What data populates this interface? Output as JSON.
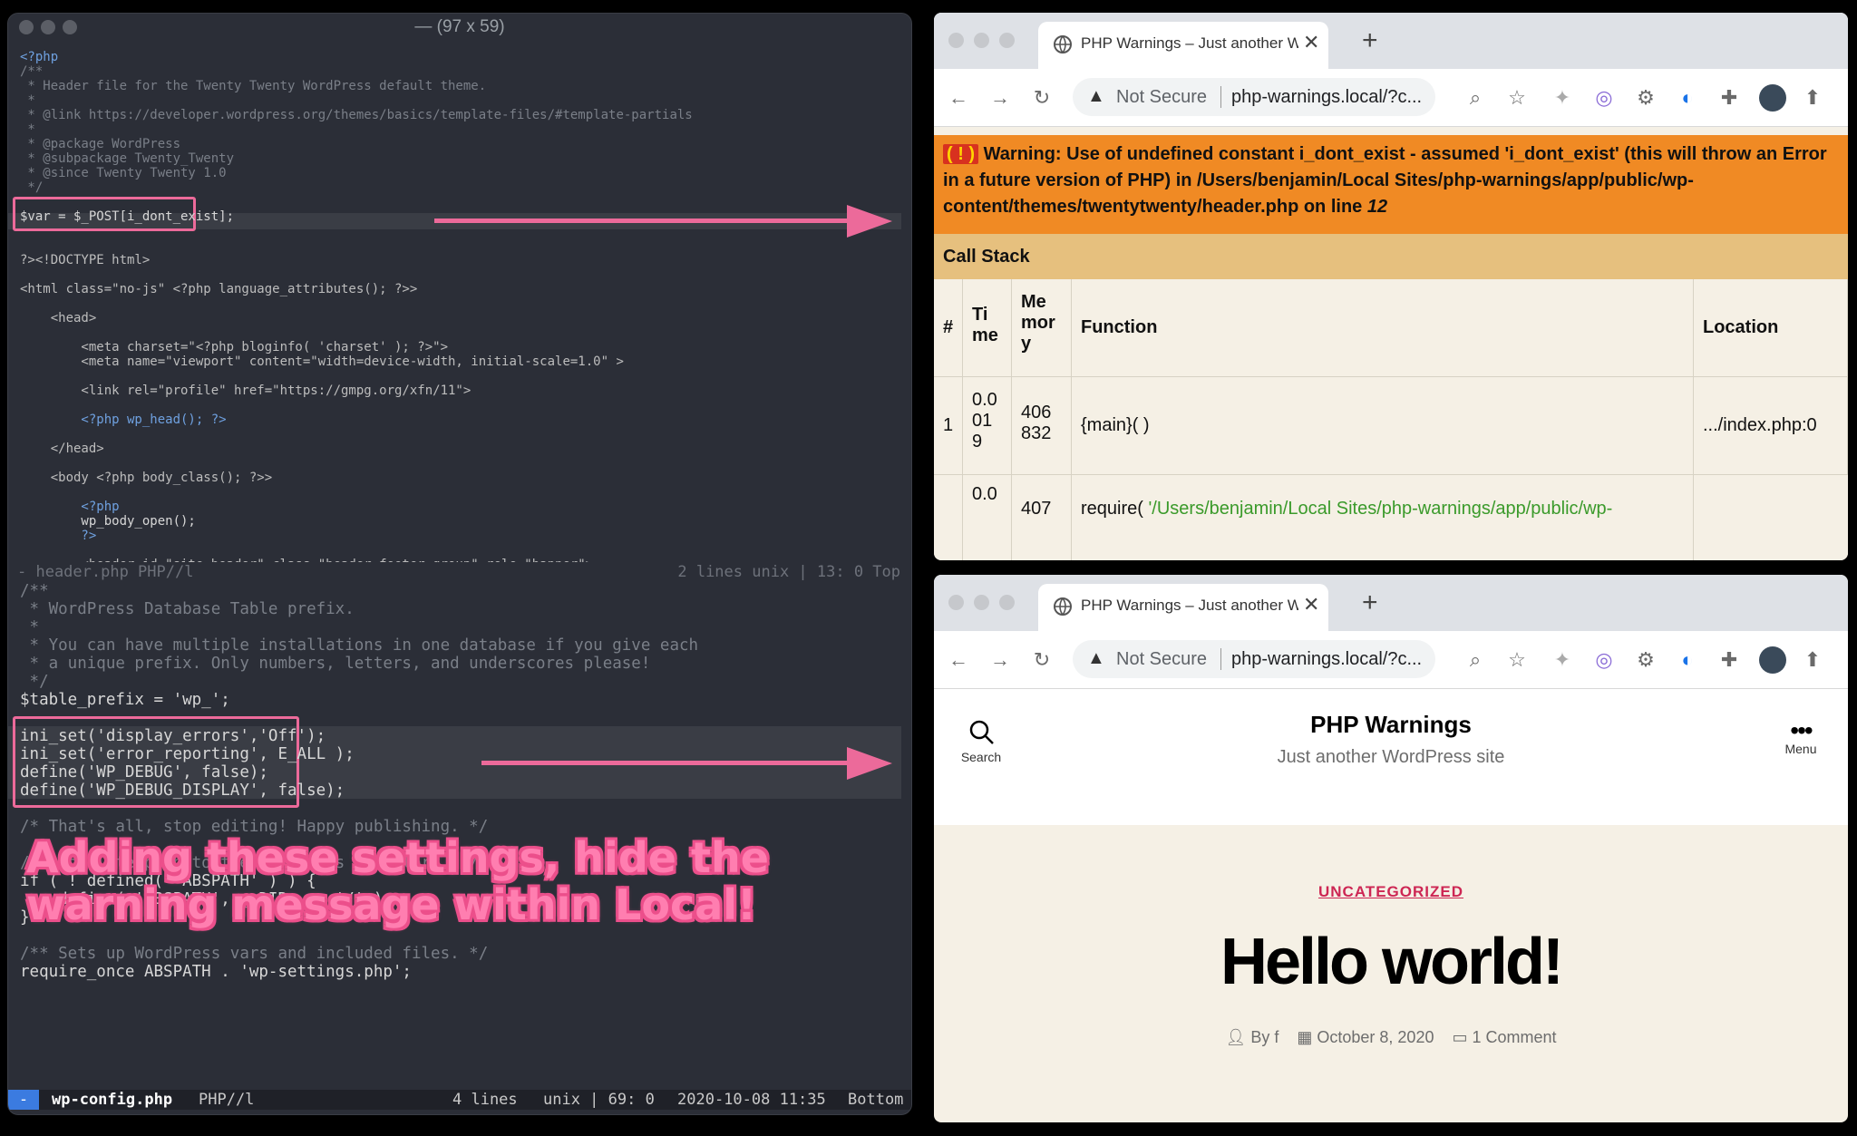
{
  "terminal": {
    "title": "— (97 x 59)",
    "top_file": {
      "lines": [
        {
          "t": "<?php",
          "c": "kw"
        },
        {
          "t": "/**",
          "c": "cm"
        },
        {
          "t": " * Header file for the Twenty Twenty WordPress default theme.",
          "c": "cm"
        },
        {
          "t": " *",
          "c": "cm"
        },
        {
          "t": " * @link https://developer.wordpress.org/themes/basics/template-files/#template-partials",
          "c": "cm"
        },
        {
          "t": " *",
          "c": "cm"
        },
        {
          "t": " * @package WordPress",
          "c": "cm"
        },
        {
          "t": " * @subpackage Twenty_Twenty",
          "c": "cm"
        },
        {
          "t": " * @since Twenty Twenty 1.0",
          "c": "cm"
        },
        {
          "t": " */",
          "c": "cm"
        },
        {
          "t": "",
          "c": "var"
        },
        {
          "t": "$var = $_POST[i_dont_exist];",
          "c": "var"
        },
        {
          "t": "",
          "c": "var"
        },
        {
          "t": "",
          "c": "var"
        },
        {
          "t": "?><!DOCTYPE html>",
          "c": "tag"
        },
        {
          "t": "",
          "c": "var"
        },
        {
          "t": "<html class=\"no-js\" <?php language_attributes(); ?>>",
          "c": "tag"
        },
        {
          "t": "",
          "c": "var"
        },
        {
          "t": "    <head>",
          "c": "tag"
        },
        {
          "t": "",
          "c": "var"
        },
        {
          "t": "        <meta charset=\"<?php bloginfo( 'charset' ); ?>\">",
          "c": "tag"
        },
        {
          "t": "        <meta name=\"viewport\" content=\"width=device-width, initial-scale=1.0\" >",
          "c": "tag"
        },
        {
          "t": "",
          "c": "var"
        },
        {
          "t": "        <link rel=\"profile\" href=\"https://gmpg.org/xfn/11\">",
          "c": "tag"
        },
        {
          "t": "",
          "c": "var"
        },
        {
          "t": "        <?php wp_head(); ?>",
          "c": "kw"
        },
        {
          "t": "",
          "c": "var"
        },
        {
          "t": "    </head>",
          "c": "tag"
        },
        {
          "t": "",
          "c": "var"
        },
        {
          "t": "    <body <?php body_class(); ?>>",
          "c": "tag"
        },
        {
          "t": "",
          "c": "var"
        },
        {
          "t": "        <?php",
          "c": "kw"
        },
        {
          "t": "        wp_body_open();",
          "c": "var"
        },
        {
          "t": "        ?>",
          "c": "kw"
        },
        {
          "t": "",
          "c": "var"
        },
        {
          "t": "        <header id=\"site-header\" class=\"header-footer-group\" role=\"banner\">",
          "c": "tag"
        }
      ],
      "status": {
        "left": "-  header.php   PHP//l",
        "right": "2 lines   unix | 13: 0   Top"
      }
    },
    "bottom_file": {
      "lines": [
        {
          "t": "/**",
          "c": "cm"
        },
        {
          "t": " * WordPress Database Table prefix.",
          "c": "cm"
        },
        {
          "t": " *",
          "c": "cm"
        },
        {
          "t": " * You can have multiple installations in one database if you give each",
          "c": "cm"
        },
        {
          "t": " * a unique prefix. Only numbers, letters, and underscores please!",
          "c": "cm"
        },
        {
          "t": " */",
          "c": "cm"
        },
        {
          "t": "$table_prefix = 'wp_';",
          "c": "var"
        },
        {
          "t": "",
          "c": "var"
        },
        {
          "t": "ini_set('display_errors','Off');",
          "c": "var"
        },
        {
          "t": "ini_set('error_reporting', E_ALL );",
          "c": "var"
        },
        {
          "t": "define('WP_DEBUG', false);",
          "c": "var"
        },
        {
          "t": "define('WP_DEBUG_DISPLAY', false);",
          "c": "var"
        },
        {
          "t": "",
          "c": "var"
        },
        {
          "t": "/* That's all, stop editing! Happy publishing. */",
          "c": "cm"
        },
        {
          "t": "",
          "c": "var"
        },
        {
          "t": "/** Absolute path to the WordPress directory. */",
          "c": "cm"
        },
        {
          "t": "if ( ! defined( 'ABSPATH' ) ) {",
          "c": "var"
        },
        {
          "t": "    define( 'ABSPATH', __DIR__ . '/' );",
          "c": "var"
        },
        {
          "t": "}",
          "c": "var"
        },
        {
          "t": "",
          "c": "var"
        },
        {
          "t": "/** Sets up WordPress vars and included files. */",
          "c": "cm"
        },
        {
          "t": "require_once ABSPATH . 'wp-settings.php';",
          "c": "var"
        }
      ],
      "status": {
        "mode": "-",
        "file": "wp-config.php",
        "type": "PHP//l",
        "lines": "4 lines",
        "pos": "unix | 69: 0",
        "time": "2020-10-08 11:35",
        "where": "Bottom"
      }
    },
    "annotation_line1": "Adding these settings, hide the",
    "annotation_line2": "warning message within Local!"
  },
  "browser_top": {
    "tab_title": "PHP Warnings – Just another W",
    "not_secure": "Not Secure",
    "url": "php-warnings.local/?c...",
    "error_badge": "( ! )",
    "error_text": "Warning: Use of undefined constant i_dont_exist - assumed 'i_dont_exist' (this will throw an Error in a future version of PHP) in /Users/benjamin/Local Sites/php-warnings/app/public/wp-content/themes/twentytwenty/header.php on line ",
    "error_line": "12",
    "call_stack": "Call Stack",
    "headers": {
      "num": "#",
      "time": "Ti me",
      "memory": "Me mor y",
      "function": "Function",
      "location": "Location"
    },
    "row1": {
      "num": "1",
      "time": "0.0 01 9",
      "memory": "406 832",
      "function": "{main}( )",
      "location": ".../index.php:0"
    },
    "row2": {
      "time": "0.0",
      "memory": "407",
      "function": "require(",
      "arg": "'/Users/benjamin/Local Sites/php-warnings/app/public/wp-"
    }
  },
  "browser_bottom": {
    "tab_title": "PHP Warnings – Just another W",
    "not_secure": "Not Secure",
    "url": "php-warnings.local/?c...",
    "site_title": "PHP Warnings",
    "site_desc": "Just another WordPress site",
    "search_label": "Search",
    "menu_label": "Menu",
    "category": "UNCATEGORIZED",
    "post_title": "Hello world!",
    "meta_author": "By f",
    "meta_date": "October 8, 2020",
    "meta_comments": "1 Comment"
  },
  "colors": {
    "accent": "#ec6a9a",
    "warning": "#f08a24",
    "callstack": "#e6c07e",
    "wp_red": "#cd2653"
  }
}
